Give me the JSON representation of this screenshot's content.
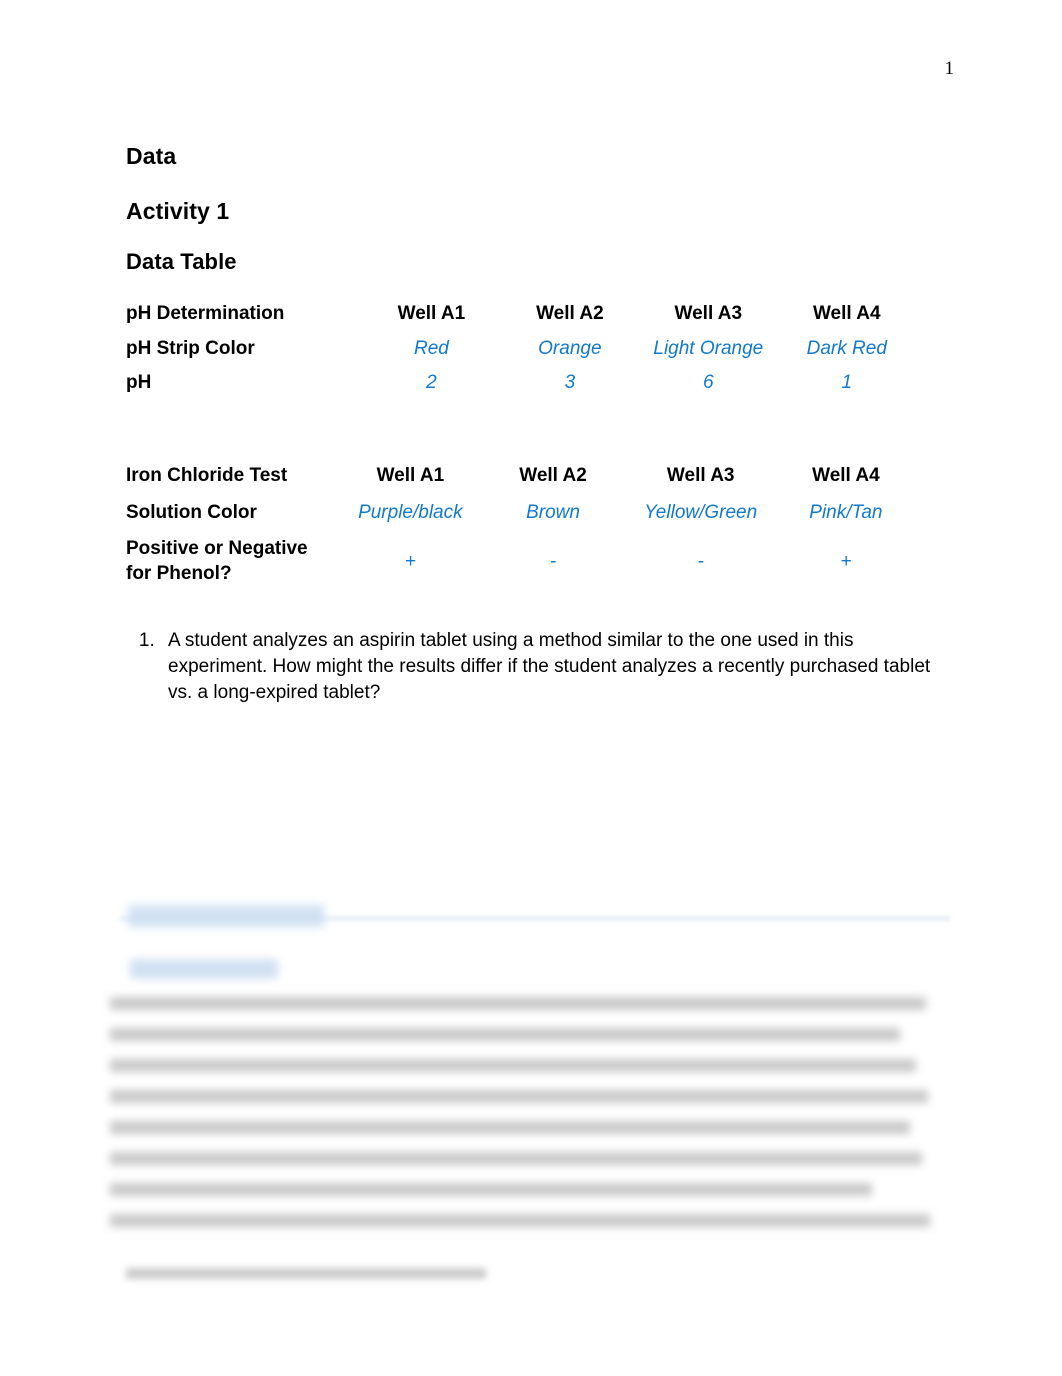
{
  "page": {
    "number": "1"
  },
  "headings": {
    "data": "Data",
    "activity": "Activity 1",
    "data_table": "Data Table"
  },
  "colors": {
    "student_answer": "#1179cf",
    "text": "#000000",
    "background": "#ffffff"
  },
  "table_ph": {
    "header_label": "pH Determination",
    "columns": [
      "Well A1",
      "Well A2",
      "Well A3",
      "Well A4"
    ],
    "rows": [
      {
        "label": "pH Strip Color",
        "values": [
          "Red",
          "Orange",
          "Light Orange",
          "Dark Red"
        ]
      },
      {
        "label": "pH",
        "values": [
          "2",
          "3",
          "6",
          "1"
        ]
      }
    ]
  },
  "table_iron": {
    "header_label": "Iron Chloride Test",
    "columns": [
      "Well A1",
      "Well A2",
      "Well A3",
      "Well A4"
    ],
    "rows": [
      {
        "label": "Solution Color",
        "values": [
          "Purple/black",
          "Brown",
          "Yellow/Green",
          "Pink/Tan"
        ]
      },
      {
        "label": "Positive or Negative for Phenol?",
        "values": [
          "+",
          "-",
          "-",
          "+"
        ]
      }
    ]
  },
  "questions": [
    {
      "number": "1.",
      "text": "A student analyzes an aspirin tablet using a method similar to the one used in this experiment. How might the results differ if the student analyzes a recently purchased tablet vs. a long-expired tablet?"
    }
  ],
  "redacted_section": {
    "note": "blurred content",
    "heading_blocks": 2,
    "paragraph_lines": 8,
    "footer_lines": 1
  }
}
